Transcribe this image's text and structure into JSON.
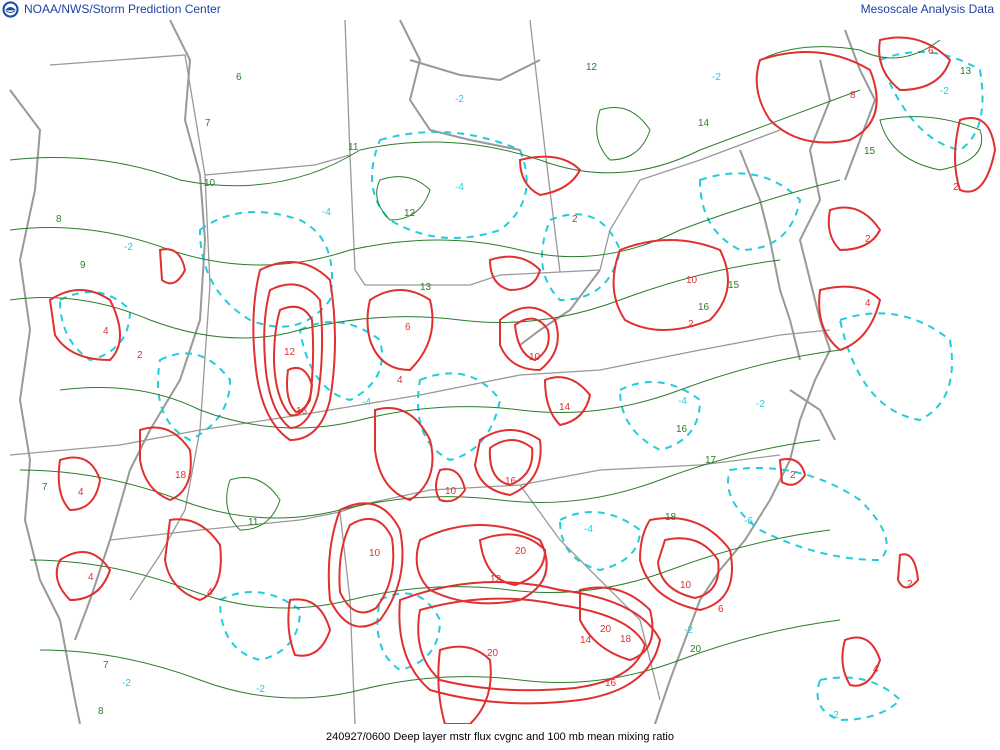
{
  "header": {
    "left_title": "NOAA/NWS/Storm Prediction Center",
    "right_title": "Mesoscale Analysis Data"
  },
  "footer": {
    "caption": "240927/0600 Deep layer mstr flux cvgnc and 100 mb mean mixing ratio"
  },
  "colors": {
    "convergence_contour": "#e03030",
    "divergence_contour": "#22ccdd",
    "mixing_ratio_contour": "#2a7d2a",
    "boundaries": "#999999",
    "header_text": "#1f3fa8"
  },
  "icons": {
    "logo": "noaa-logo-icon"
  },
  "map": {
    "mixing_ratio_labels": [
      "6",
      "7",
      "8",
      "9",
      "10",
      "11",
      "12",
      "13",
      "14",
      "15",
      "16",
      "17",
      "18",
      "20"
    ],
    "convergence_labels": [
      "2",
      "4",
      "6",
      "8",
      "10",
      "12",
      "14",
      "16",
      "18",
      "20"
    ],
    "divergence_labels": [
      "-2",
      "-4",
      "-6"
    ]
  }
}
